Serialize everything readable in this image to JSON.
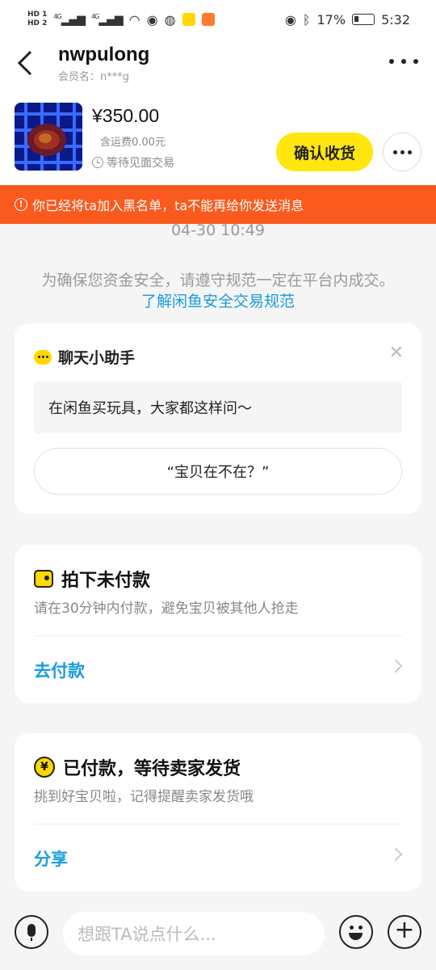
{
  "status_bar": {
    "hd1": "HD 1",
    "hd2": "HD 2",
    "signal1": "4G",
    "signal2": "4G",
    "battery": "17%",
    "time": "5:32"
  },
  "header": {
    "title": "nwpulong",
    "member_label": "会员名：n***g"
  },
  "product": {
    "price": "¥350.00",
    "shipping": "含运费0.00元",
    "status": "等待见面交易",
    "confirm_button": "确认收货"
  },
  "banner": {
    "text": "你已经将ta加入黑名单，ta不能再给你发送消息"
  },
  "chat": {
    "timestamp": "04-30 10:49",
    "notice": "为确保您资金安全，请遵守规范一定在平台内成交。",
    "notice_link": "了解闲鱼安全交易规范"
  },
  "assistant": {
    "title": "聊天小助手",
    "suggestion": "在闲鱼买玩具，大家都这样问～",
    "quick_reply": "“宝贝在不在？”"
  },
  "pay_card": {
    "title": "拍下未付款",
    "subtitle": "请在30分钟内付款，避免宝贝被其他人抢走",
    "action": "去付款"
  },
  "paid_card": {
    "title": "已付款，等待卖家发货",
    "subtitle": "挑到好宝贝啦，记得提醒卖家发货哦",
    "action": "分享"
  },
  "input_bar": {
    "placeholder": "想跟TA说点什么..."
  },
  "colors": {
    "accent_yellow": "#ffe60f",
    "banner_red": "#fa5a1e",
    "link_blue": "#1a9de0"
  }
}
